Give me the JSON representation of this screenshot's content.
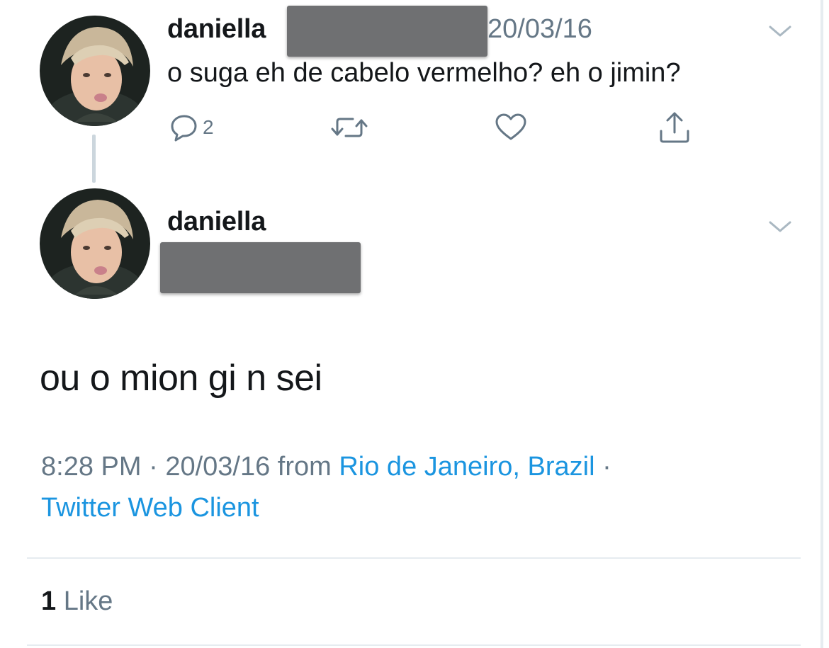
{
  "parent_tweet": {
    "username": "daniella",
    "date": "20/03/16",
    "text": "o suga eh de cabelo vermelho? eh o jimin?",
    "actions": {
      "reply_count": "2",
      "reply_icon": "reply-icon",
      "retweet_icon": "retweet-icon",
      "like_icon": "heart-icon",
      "share_icon": "share-icon"
    }
  },
  "main_tweet": {
    "username": "daniella",
    "text": "ou o mion gi n sei",
    "time": "8:28 PM",
    "separator": "·",
    "date": "20/03/16",
    "from_label": "from",
    "location": "Rio de Janeiro, Brazil",
    "client": "Twitter Web Client",
    "like_count": "1",
    "like_label": "Like"
  },
  "colors": {
    "text": "#14171a",
    "secondary": "#657786",
    "link": "#1b95e0",
    "divider": "#e6ecf0",
    "redaction": "#6f7072"
  }
}
